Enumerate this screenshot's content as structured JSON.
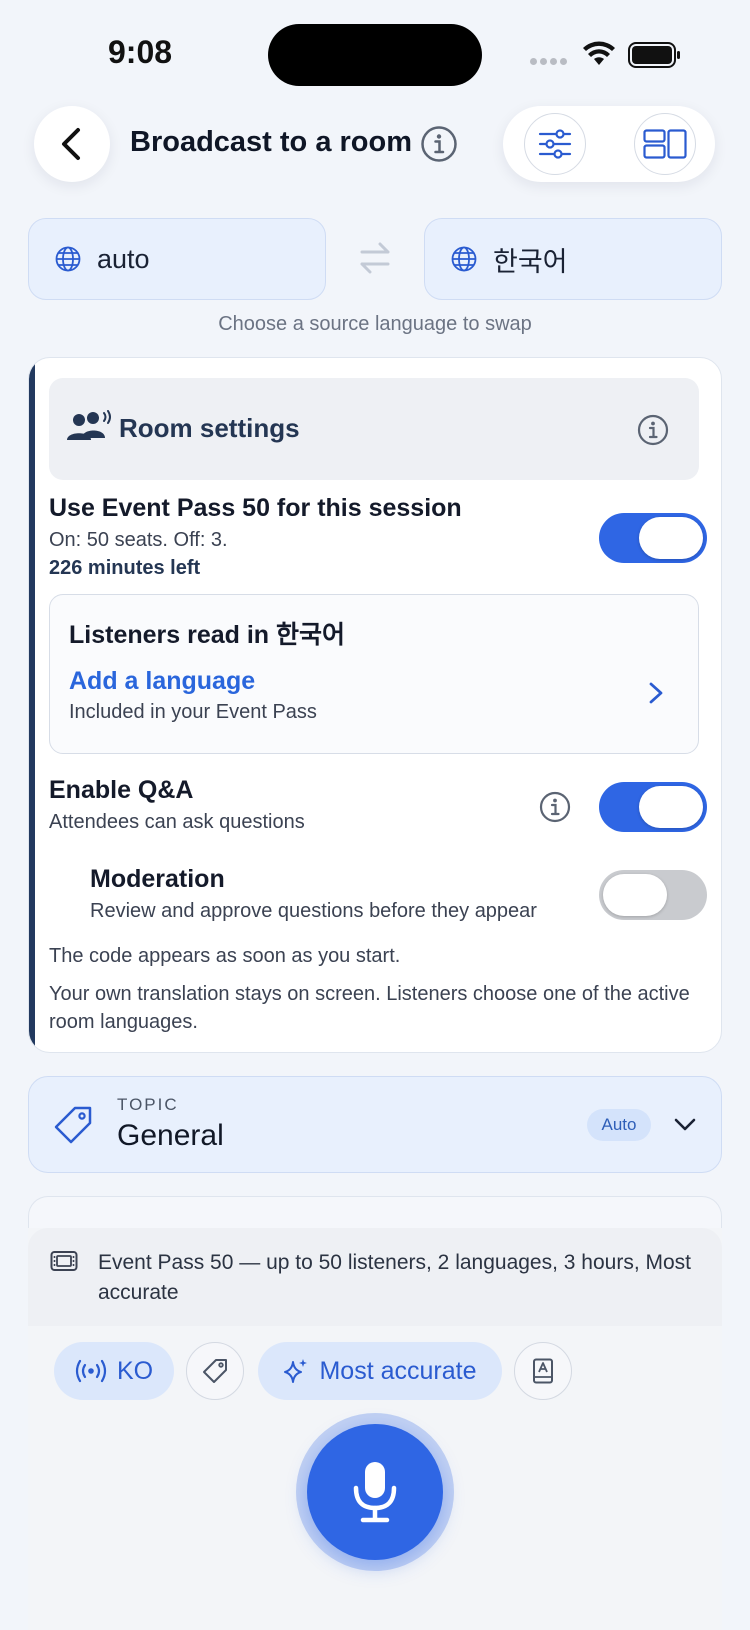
{
  "status_bar": {
    "time": "9:08"
  },
  "header": {
    "title": "Broadcast to a room"
  },
  "language": {
    "source": "auto",
    "target": "한국어",
    "hint": "Choose a source language to swap"
  },
  "room_settings": {
    "title": "Room settings",
    "event_pass": {
      "title": "Use Event Pass 50 for this session",
      "subtitle": "On: 50 seats. Off: 3.",
      "remaining": "226 minutes left",
      "enabled": true
    },
    "listeners": {
      "title": "Listeners read in 한국어",
      "add_label": "Add a language",
      "add_sub": "Included in your Event Pass"
    },
    "qa": {
      "title": "Enable Q&A",
      "subtitle": "Attendees can ask questions",
      "enabled": true
    },
    "moderation": {
      "title": "Moderation",
      "subtitle": "Review and approve questions before they appear",
      "enabled": false
    },
    "note_code": "The code appears as soon as you start.",
    "note_translation": "Your own translation stays on screen. Listeners choose one of the active room languages."
  },
  "topic": {
    "label": "TOPIC",
    "value": "General",
    "badge": "Auto"
  },
  "pass_info": "Event Pass 50 — up to 50 listeners, 2 languages, 3 hours, Most accurate",
  "toolbar": {
    "language_chip": "KO",
    "quality_chip": "Most accurate"
  },
  "colors": {
    "accent": "#2f66e4",
    "card_accent": "#22395f",
    "background": "#f2f5fa"
  },
  "icons": [
    "back-icon",
    "info-icon",
    "sliders-icon",
    "layout-icon",
    "globe-icon",
    "swap-icon",
    "people-speaking-icon",
    "chevron-right-icon",
    "tag-icon",
    "chevron-down-icon",
    "ticket-icon",
    "broadcast-icon",
    "sparkle-icon",
    "glossary-icon",
    "microphone-icon"
  ]
}
